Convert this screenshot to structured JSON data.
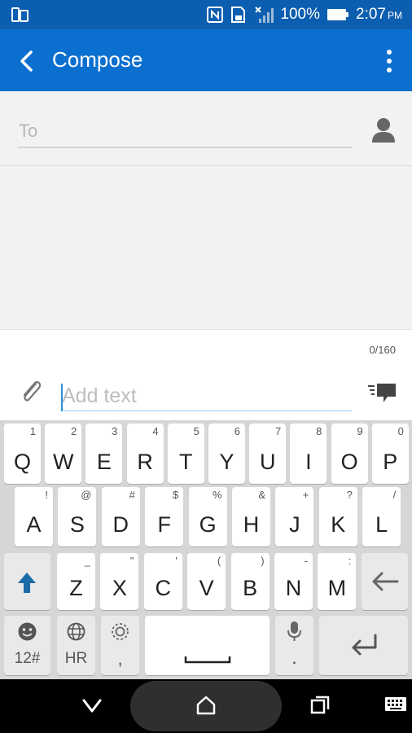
{
  "status_bar": {
    "battery": "100%",
    "time": "2:07",
    "ampm": "PM"
  },
  "appbar": {
    "title": "Compose"
  },
  "to_field": {
    "placeholder": "To"
  },
  "compose": {
    "char_count": "0/160",
    "text_placeholder": "Add text",
    "text_value": ""
  },
  "keyboard": {
    "row1": [
      {
        "key": "Q",
        "sub": "1"
      },
      {
        "key": "W",
        "sub": "2"
      },
      {
        "key": "E",
        "sub": "3"
      },
      {
        "key": "R",
        "sub": "4"
      },
      {
        "key": "T",
        "sub": "5"
      },
      {
        "key": "Y",
        "sub": "6"
      },
      {
        "key": "U",
        "sub": "7"
      },
      {
        "key": "I",
        "sub": "8"
      },
      {
        "key": "O",
        "sub": "9"
      },
      {
        "key": "P",
        "sub": "0"
      }
    ],
    "row2": [
      {
        "key": "A",
        "sub": "!"
      },
      {
        "key": "S",
        "sub": "@"
      },
      {
        "key": "D",
        "sub": "#"
      },
      {
        "key": "F",
        "sub": "$"
      },
      {
        "key": "G",
        "sub": "%"
      },
      {
        "key": "H",
        "sub": "&"
      },
      {
        "key": "J",
        "sub": "+"
      },
      {
        "key": "K",
        "sub": "?"
      },
      {
        "key": "L",
        "sub": "/"
      }
    ],
    "row3": [
      {
        "key": "Z",
        "sub": "_"
      },
      {
        "key": "X",
        "sub": "\""
      },
      {
        "key": "C",
        "sub": "'"
      },
      {
        "key": "V",
        "sub": "("
      },
      {
        "key": "B",
        "sub": ")"
      },
      {
        "key": "N",
        "sub": "-"
      },
      {
        "key": "M",
        "sub": ":"
      }
    ],
    "symbols_label": "12#",
    "language_label": "HR",
    "comma_label": ",",
    "period_label": "."
  },
  "colors": {
    "status_bar": "#0b5eb0",
    "appbar": "#0b6fcf",
    "accent": "#1a6aa8"
  }
}
